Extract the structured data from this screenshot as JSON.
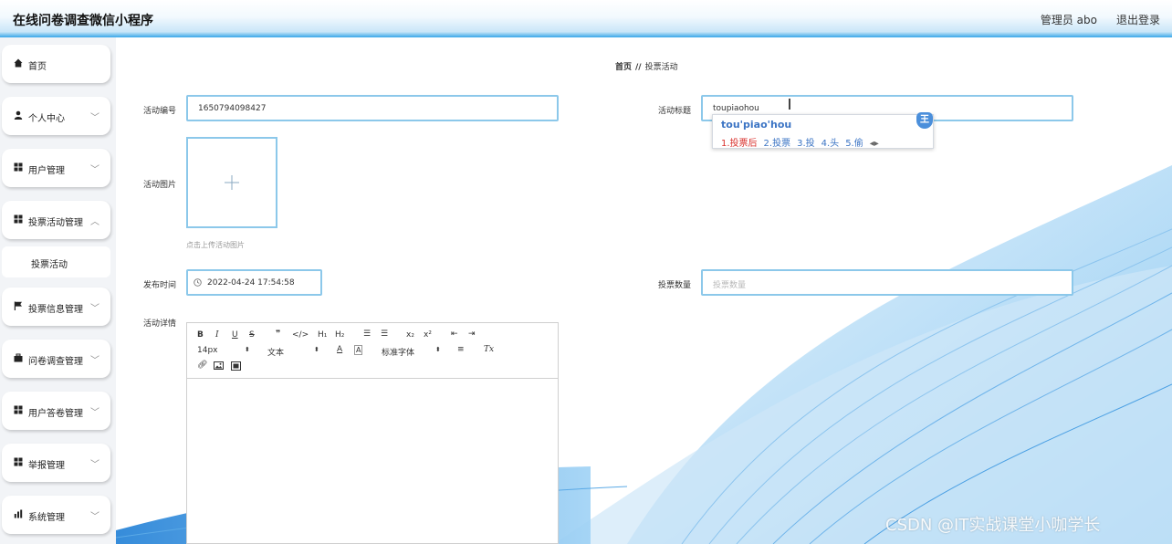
{
  "header": {
    "title": "在线问卷调查微信小程序",
    "admin_label": "管理员 abo",
    "logout_label": "退出登录"
  },
  "sidebar": {
    "items": [
      {
        "label": "首页",
        "icon": "home-icon"
      },
      {
        "label": "个人中心",
        "icon": "user-icon"
      },
      {
        "label": "用户管理",
        "icon": "grid-icon"
      },
      {
        "label": "投票活动管理",
        "icon": "grid-icon"
      },
      {
        "label": "投票信息管理",
        "icon": "flag-icon"
      },
      {
        "label": "问卷调查管理",
        "icon": "briefcase-icon"
      },
      {
        "label": "用户答卷管理",
        "icon": "grid-icon"
      },
      {
        "label": "举报管理",
        "icon": "grid-icon"
      },
      {
        "label": "系统管理",
        "icon": "bar-chart-icon"
      }
    ],
    "sub_items": [
      {
        "label": "投票活动"
      }
    ]
  },
  "breadcrumb": {
    "home": "首页",
    "separator": "//",
    "current": "投票活动"
  },
  "form": {
    "activity_no": {
      "label": "活动编号",
      "value": "1650794098427"
    },
    "activity_title": {
      "label": "活动标题",
      "value": "toupiaohou"
    },
    "activity_image": {
      "label": "活动图片",
      "hint": "点击上传活动图片"
    },
    "publish_time": {
      "label": "发布时间",
      "value": "2022-04-24 17:54:58"
    },
    "vote_count": {
      "label": "投票数量",
      "placeholder": "投票数量"
    },
    "details": {
      "label": "活动详情"
    }
  },
  "ime": {
    "composition": "tou'piao'hou",
    "candidates": [
      "1.投票后",
      "2.投票",
      "3.投",
      "4.头",
      "5.偷"
    ],
    "badge": "王"
  },
  "editor": {
    "font_size": "14px",
    "header_select": "文本",
    "font_family": "标准字体",
    "colors": {
      "accent": "#8cc8ea"
    }
  },
  "watermark": "CSDN @IT实战课堂小咖学长"
}
